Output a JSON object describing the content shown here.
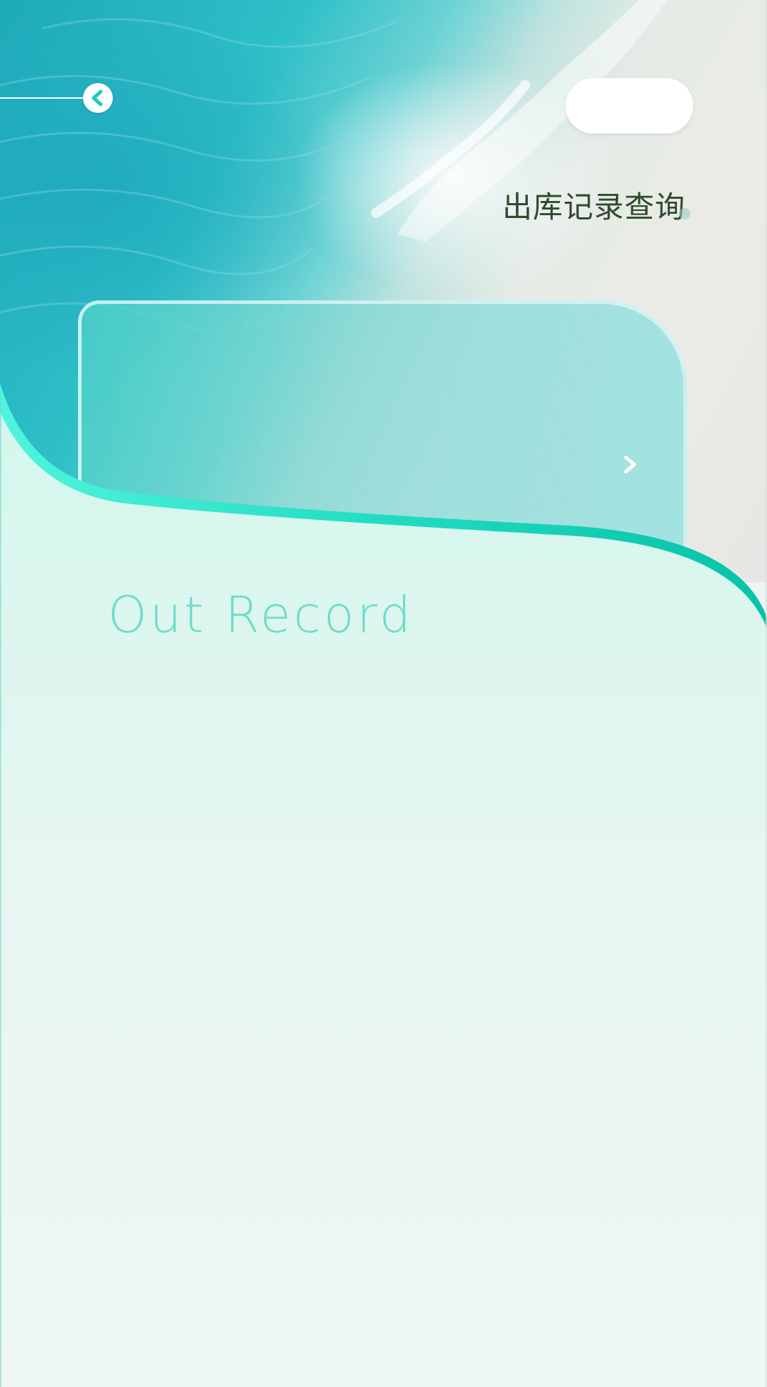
{
  "header": {
    "title": "出库记录查询",
    "back_icon": "chevron-left-icon",
    "action_label": ""
  },
  "card": {
    "arrow_icon": "chevron-right-icon"
  },
  "section": {
    "heading": "Out Record"
  },
  "colors": {
    "accent": "#1ccfb4",
    "accent_light": "#4ff0dc",
    "heading": "#6ddccb",
    "title": "#2f4a2d",
    "panel_top": "#d6f7ee",
    "panel_bottom": "#eff7f5"
  }
}
